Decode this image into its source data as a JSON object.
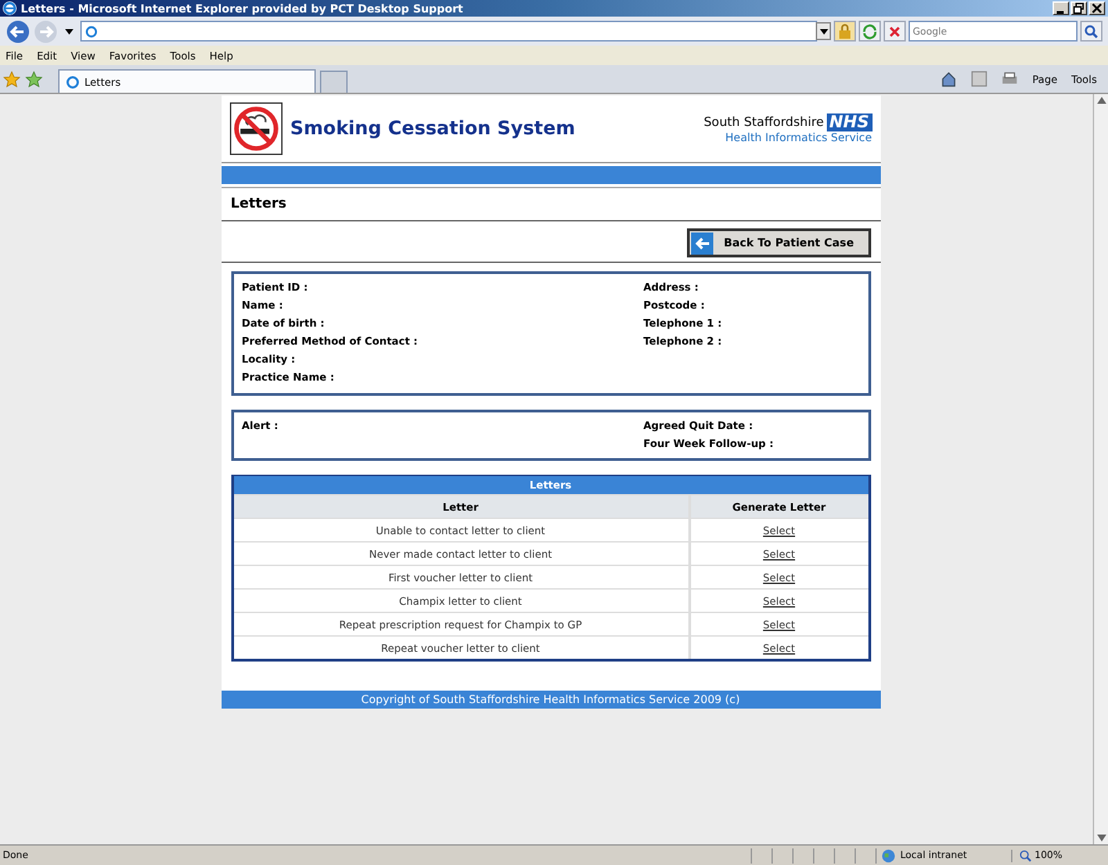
{
  "window": {
    "title": "Letters - Microsoft Internet Explorer provided by PCT Desktop Support"
  },
  "search": {
    "placeholder": "Google"
  },
  "menu": [
    "File",
    "Edit",
    "View",
    "Favorites",
    "Tools",
    "Help"
  ],
  "tabs": [
    {
      "label": "Letters",
      "selected": true
    }
  ],
  "command_bar": [
    "Page",
    "Tools"
  ],
  "page": {
    "title": "Smoking Cessation System",
    "org_name": "South Staffordshire",
    "org_badge": "NHS",
    "org_service": "Health Informatics Service",
    "heading": "Letters",
    "back_button": "Back To Patient Case",
    "patient_left": [
      "Patient ID :",
      "Name :",
      "Date of birth :",
      "Preferred Method of Contact :",
      "Locality :",
      "Practice Name :"
    ],
    "patient_right": [
      "Address :",
      "Postcode :",
      "Telephone 1 :",
      "Telephone 2 :"
    ],
    "alert_left": [
      "Alert :"
    ],
    "alert_right": [
      "Agreed Quit Date :",
      "Four Week Follow-up :"
    ],
    "letters": {
      "title": "Letters",
      "columns": [
        "Letter",
        "Generate Letter"
      ],
      "rows": [
        {
          "letter": "Unable to contact letter to client",
          "action": "Select"
        },
        {
          "letter": "Never made contact letter to client",
          "action": "Select"
        },
        {
          "letter": "First voucher letter to client",
          "action": "Select"
        },
        {
          "letter": "Champix letter to client",
          "action": "Select"
        },
        {
          "letter": "Repeat prescription request for Champix to GP",
          "action": "Select"
        },
        {
          "letter": "Repeat voucher letter to client",
          "action": "Select"
        }
      ]
    },
    "footer": "Copyright of South Staffordshire Health Informatics Service 2009 (c)"
  },
  "status_bar": {
    "text": "Done",
    "zone": "Local intranet",
    "zoom": "100%"
  }
}
